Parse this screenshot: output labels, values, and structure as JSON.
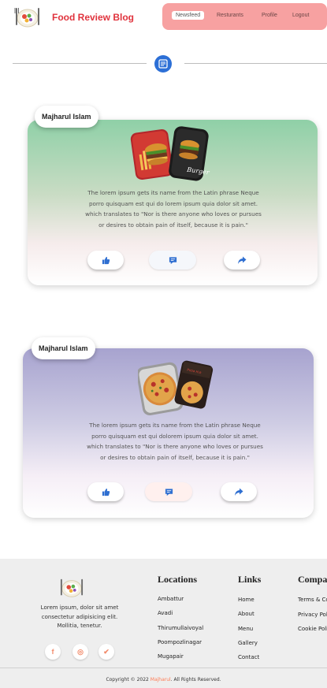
{
  "header": {
    "brand": "Food Review Blog",
    "nav": [
      {
        "label": "Newsfeed",
        "active": true
      },
      {
        "label": "Resturants",
        "active": false
      },
      {
        "label": "Profile",
        "active": false
      },
      {
        "label": "Logout",
        "active": false
      }
    ]
  },
  "posts": [
    {
      "author": "Majharul Islam",
      "text": "The lorem ipsum gets its name from the Latin phrase Neque porro quisquam est qui do lorem ipsum quia dolor sit amet. which translates to \"Nor is there anyone who loves or pursues or desires to obtain pain of itself, because it is pain.\"",
      "image_caption": "Burger"
    },
    {
      "author": "Majharul Islam",
      "text": "The lorem ipsum gets its name from the Latin phrase Neque porro quisquam est qui dolorem ipsum quia dolor sit amet. which translates to \"Nor is there anyone who loves or pursues or desires to obtain pain of itself, because it is pain.\"",
      "image_caption": "Pizza Hut"
    }
  ],
  "footer": {
    "description": "Lorem ipsum, dolor sit amet consectetur adipisicing elit. Mollitia, tenetur.",
    "social": [
      "f",
      "◎",
      "✔"
    ],
    "columns": [
      {
        "title": "Locations",
        "items": [
          "Ambattur",
          "Avadi",
          "Thirumullaivoyal",
          "Poompozlinagar",
          "Mugapair"
        ]
      },
      {
        "title": "Links",
        "items": [
          "Home",
          "About",
          "Menu",
          "Gallery",
          "Contact"
        ]
      },
      {
        "title": "Compa",
        "items": [
          "Terms & Co",
          "Privacy Pol",
          "Cookie Poli"
        ]
      }
    ],
    "copyright_prefix": "Copyright © 2022",
    "copyright_name": "Majharul",
    "copyright_suffix": "All Rights Reserved."
  },
  "colors": {
    "brand": "#e0333d",
    "nav_bg": "#f7a1a1",
    "accent_blue": "#2c6fd6",
    "highlight": "#ff7b54"
  }
}
